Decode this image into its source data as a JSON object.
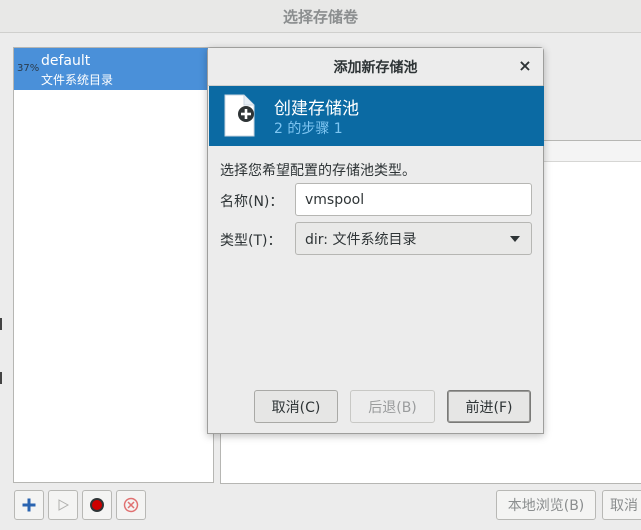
{
  "window": {
    "title": "选择存储卷"
  },
  "pools": [
    {
      "usage": "37%",
      "name": "default",
      "subtitle": "文件系统目录"
    }
  ],
  "bottom_toolbar": {
    "add_icon": "plus-icon",
    "start_icon": "play-icon",
    "stop_icon": "record-icon",
    "delete_icon": "delete-circle-icon",
    "browse_label": "本地浏览(B)",
    "cancel_label": "取消"
  },
  "dialog": {
    "title": "添加新存储池",
    "close": "×",
    "banner": {
      "title": "创建存储池",
      "step": "2 的步骤 1",
      "icon": "new-storage-file-icon"
    },
    "prompt": "选择您希望配置的存储池类型。",
    "name_label": "名称(N)：",
    "name_value": "vmspool",
    "type_label": "类型(T)：",
    "type_value": "dir: 文件系统目录",
    "buttons": {
      "cancel": "取消(C)",
      "back": "后退(B)",
      "forward": "前进(F)"
    }
  },
  "colors": {
    "selection": "#4a90d9",
    "banner": "#0b6aa3",
    "banner_step": "#7fc6f2"
  }
}
